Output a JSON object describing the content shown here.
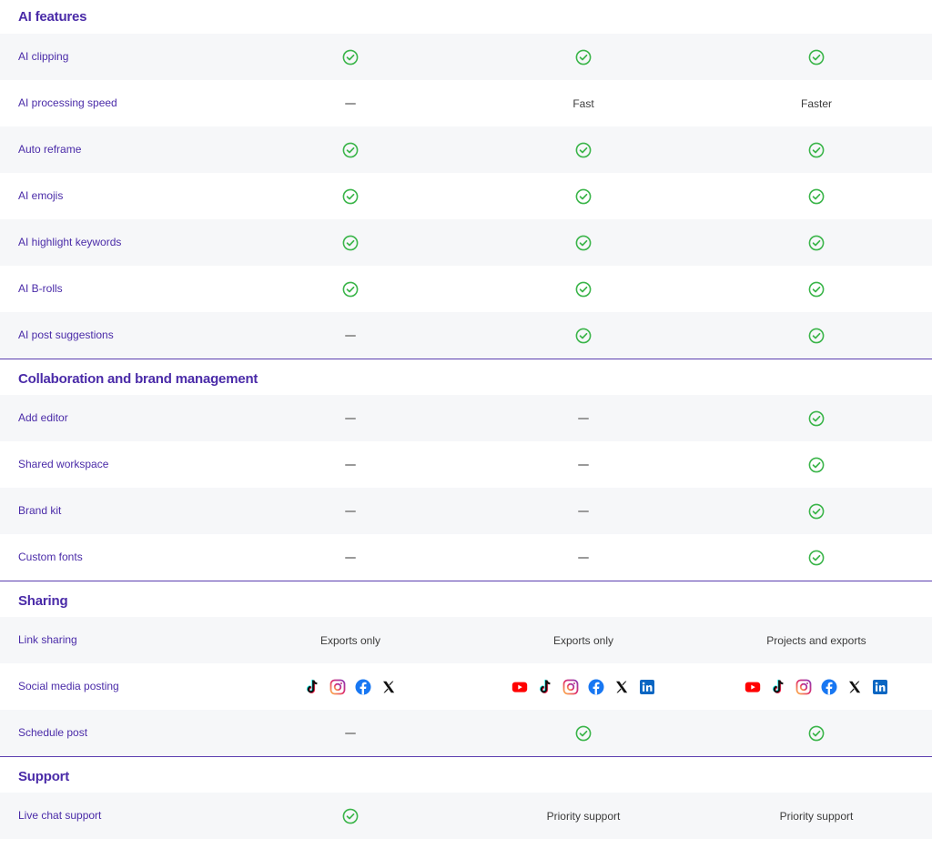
{
  "colors": {
    "accent": "#4a2ba8",
    "divider": "#5b3fb0",
    "check": "#3bb54a",
    "dash": "#9a9a9a",
    "row_shade": "#f6f7f9"
  },
  "sections": [
    {
      "title": "AI features",
      "rows": [
        {
          "label": "AI clipping",
          "cells": [
            {
              "type": "check"
            },
            {
              "type": "check"
            },
            {
              "type": "check"
            }
          ]
        },
        {
          "label": "AI processing speed",
          "cells": [
            {
              "type": "dash"
            },
            {
              "type": "text",
              "text": "Fast"
            },
            {
              "type": "text",
              "text": "Faster"
            }
          ]
        },
        {
          "label": "Auto reframe",
          "cells": [
            {
              "type": "check"
            },
            {
              "type": "check"
            },
            {
              "type": "check"
            }
          ]
        },
        {
          "label": "AI emojis",
          "cells": [
            {
              "type": "check"
            },
            {
              "type": "check"
            },
            {
              "type": "check"
            }
          ]
        },
        {
          "label": "AI highlight keywords",
          "cells": [
            {
              "type": "check"
            },
            {
              "type": "check"
            },
            {
              "type": "check"
            }
          ]
        },
        {
          "label": "AI B-rolls",
          "cells": [
            {
              "type": "check"
            },
            {
              "type": "check"
            },
            {
              "type": "check"
            }
          ]
        },
        {
          "label": "AI post suggestions",
          "cells": [
            {
              "type": "dash"
            },
            {
              "type": "check"
            },
            {
              "type": "check"
            }
          ]
        }
      ]
    },
    {
      "title": "Collaboration and brand management",
      "rows": [
        {
          "label": "Add editor",
          "cells": [
            {
              "type": "dash"
            },
            {
              "type": "dash"
            },
            {
              "type": "check"
            }
          ]
        },
        {
          "label": "Shared workspace",
          "cells": [
            {
              "type": "dash"
            },
            {
              "type": "dash"
            },
            {
              "type": "check"
            }
          ]
        },
        {
          "label": "Brand kit",
          "cells": [
            {
              "type": "dash"
            },
            {
              "type": "dash"
            },
            {
              "type": "check"
            }
          ]
        },
        {
          "label": "Custom fonts",
          "cells": [
            {
              "type": "dash"
            },
            {
              "type": "dash"
            },
            {
              "type": "check"
            }
          ]
        }
      ]
    },
    {
      "title": "Sharing",
      "rows": [
        {
          "label": "Link sharing",
          "cells": [
            {
              "type": "text",
              "text": "Exports only"
            },
            {
              "type": "text",
              "text": "Exports only"
            },
            {
              "type": "text",
              "text": "Projects and exports"
            }
          ]
        },
        {
          "label": "Social media posting",
          "cells": [
            {
              "type": "social",
              "icons": [
                "tiktok-icon",
                "instagram-icon",
                "facebook-icon",
                "x-icon"
              ]
            },
            {
              "type": "social",
              "icons": [
                "youtube-icon",
                "tiktok-icon",
                "instagram-icon",
                "facebook-icon",
                "x-icon",
                "linkedin-icon"
              ]
            },
            {
              "type": "social",
              "icons": [
                "youtube-icon",
                "tiktok-icon",
                "instagram-icon",
                "facebook-icon",
                "x-icon",
                "linkedin-icon"
              ]
            }
          ]
        },
        {
          "label": "Schedule post",
          "cells": [
            {
              "type": "dash"
            },
            {
              "type": "check"
            },
            {
              "type": "check"
            }
          ]
        }
      ]
    },
    {
      "title": "Support",
      "rows": [
        {
          "label": "Live chat support",
          "cells": [
            {
              "type": "check"
            },
            {
              "type": "text",
              "text": "Priority support"
            },
            {
              "type": "text",
              "text": "Priority support"
            }
          ]
        }
      ]
    }
  ]
}
